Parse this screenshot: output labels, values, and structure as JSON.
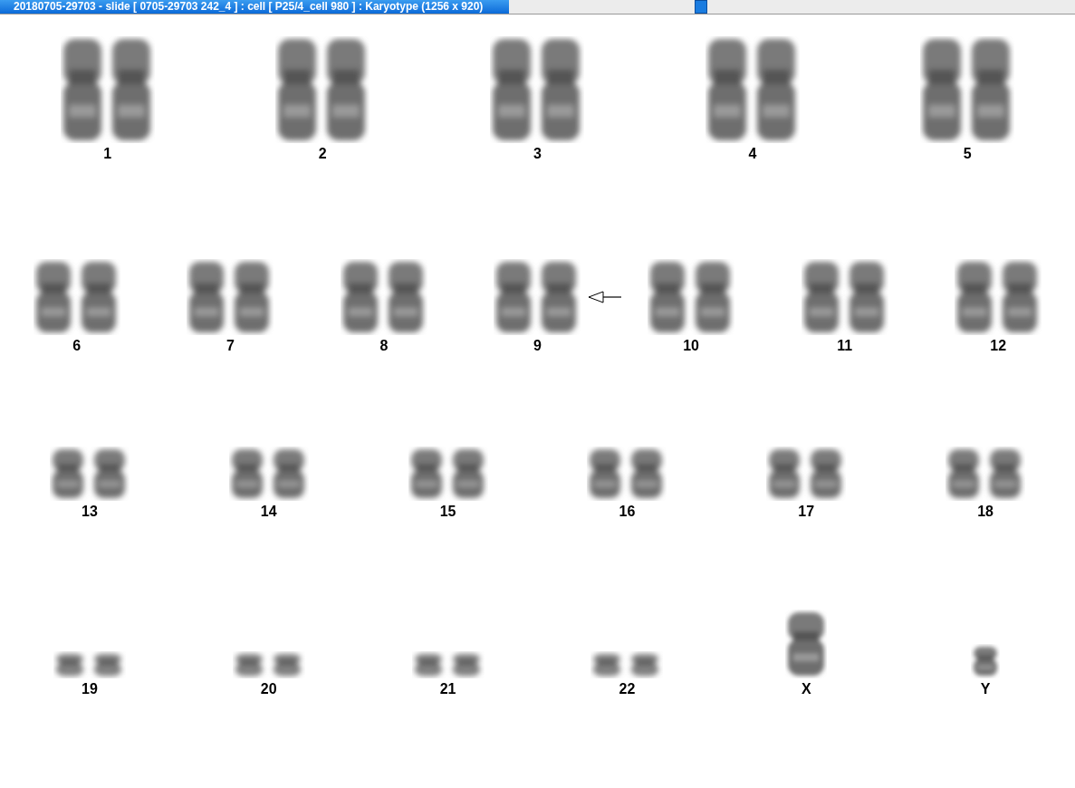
{
  "window": {
    "title": "20180705-29703 - slide [ 0705-29703 242_4 ] : cell [ P25/4_cell 980 ] : Karyotype  (1256 x 920)"
  },
  "rows": [
    {
      "items": [
        {
          "label": "1",
          "kind": "pair",
          "marked": false
        },
        {
          "label": "2",
          "kind": "pair",
          "marked": false
        },
        {
          "label": "3",
          "kind": "pair",
          "marked": false
        },
        {
          "label": "4",
          "kind": "pair",
          "marked": false
        },
        {
          "label": "5",
          "kind": "pair",
          "marked": false
        }
      ]
    },
    {
      "items": [
        {
          "label": "6",
          "kind": "pair",
          "marked": false
        },
        {
          "label": "7",
          "kind": "pair",
          "marked": false
        },
        {
          "label": "8",
          "kind": "pair",
          "marked": false
        },
        {
          "label": "9",
          "kind": "pair",
          "marked": true
        },
        {
          "label": "10",
          "kind": "pair",
          "marked": false
        },
        {
          "label": "11",
          "kind": "pair",
          "marked": false
        },
        {
          "label": "12",
          "kind": "pair",
          "marked": false
        }
      ]
    },
    {
      "items": [
        {
          "label": "13",
          "kind": "pair",
          "marked": false
        },
        {
          "label": "14",
          "kind": "pair",
          "marked": false
        },
        {
          "label": "15",
          "kind": "pair",
          "marked": false
        },
        {
          "label": "16",
          "kind": "pair",
          "marked": false
        },
        {
          "label": "17",
          "kind": "pair",
          "marked": false
        },
        {
          "label": "18",
          "kind": "pair",
          "marked": false
        }
      ]
    },
    {
      "items": [
        {
          "label": "19",
          "kind": "pair",
          "marked": false
        },
        {
          "label": "20",
          "kind": "pair",
          "marked": false
        },
        {
          "label": "21",
          "kind": "pair",
          "marked": false
        },
        {
          "label": "22",
          "kind": "pair",
          "marked": false
        },
        {
          "label": "X",
          "kind": "large",
          "marked": false
        },
        {
          "label": "Y",
          "kind": "small",
          "marked": false
        }
      ]
    }
  ]
}
